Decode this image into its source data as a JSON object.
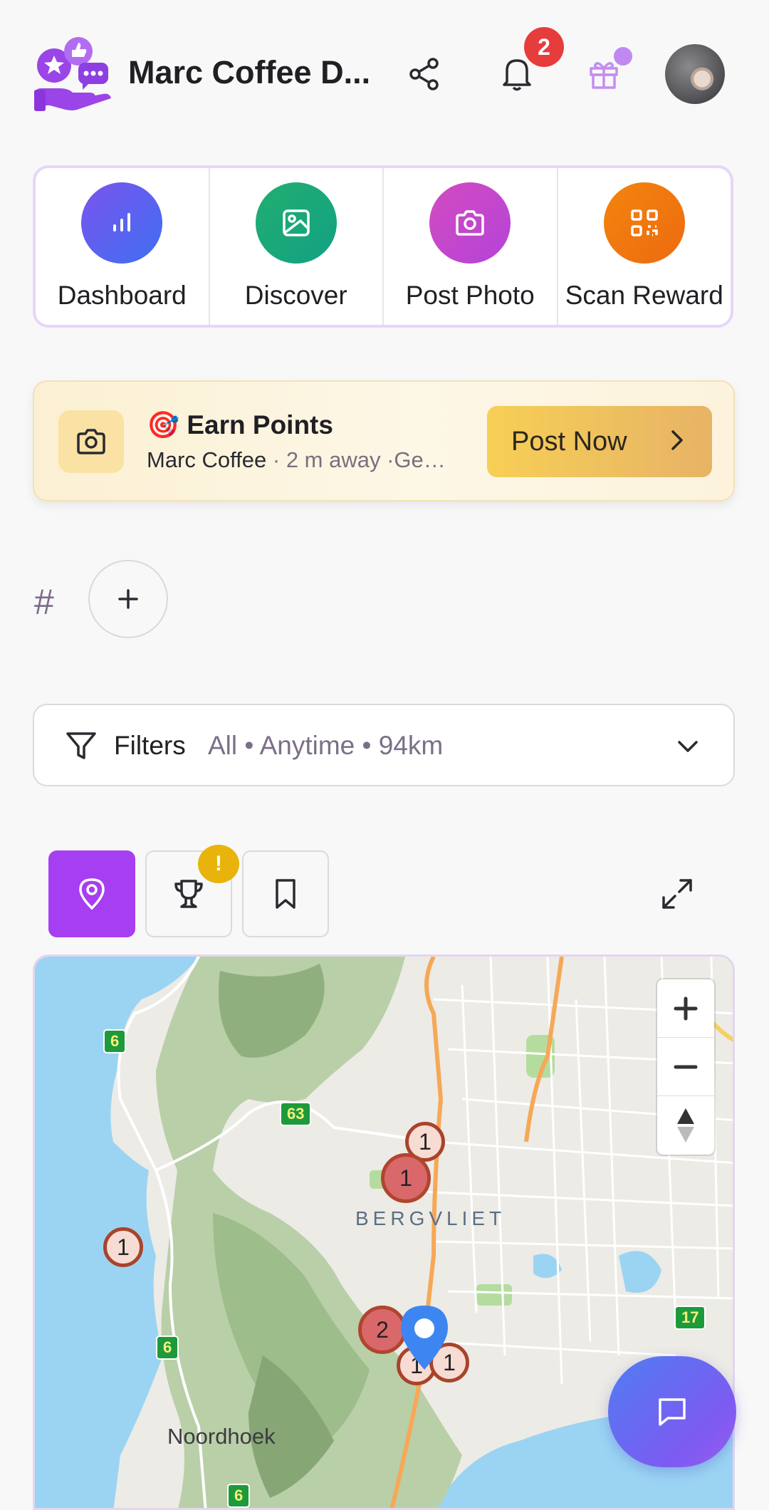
{
  "header": {
    "app_title": "Marc Coffee D...",
    "notification_count": "2",
    "icons": [
      "community-logo-icon",
      "share-icon",
      "bell-icon",
      "gift-icon",
      "avatar"
    ]
  },
  "quick_actions": [
    {
      "label": "Dashboard",
      "icon": "bar-chart-icon",
      "color": "#6a5af0"
    },
    {
      "label": "Discover",
      "icon": "image-icon",
      "color": "#1eaa74"
    },
    {
      "label": "Post Photo",
      "icon": "camera-icon",
      "color": "#c447cf"
    },
    {
      "label": "Scan Reward",
      "icon": "qr-code-icon",
      "color": "#f07d10"
    }
  ],
  "earn_points": {
    "emoji": "🎯",
    "title": "Earn Points",
    "place": "Marc Coffee",
    "details": " · 2 m away ·Ge…",
    "button_label": "Post Now"
  },
  "hashtags": {
    "hash_symbol": "#",
    "add_label": "+"
  },
  "filters": {
    "label": "Filters",
    "summary": "All • Anytime • 94km"
  },
  "view_tabs": {
    "tabs": [
      "map-pin-icon",
      "trophy-icon",
      "bookmark-icon"
    ],
    "badge": "!"
  },
  "map": {
    "places": {
      "suburb": "BERGVLIET",
      "town": "Noordhoek"
    },
    "road_shields": [
      "6",
      "63",
      "6",
      "6",
      "17"
    ],
    "clusters": [
      "1",
      "1",
      "1",
      "2",
      "1",
      "1"
    ],
    "zoom_in": "+",
    "zoom_out": "−"
  },
  "colors": {
    "accent": "#a63ef1",
    "badge_red": "#e73c3c",
    "earn_button": "#f7cf55",
    "warning": "#e8b40b"
  }
}
